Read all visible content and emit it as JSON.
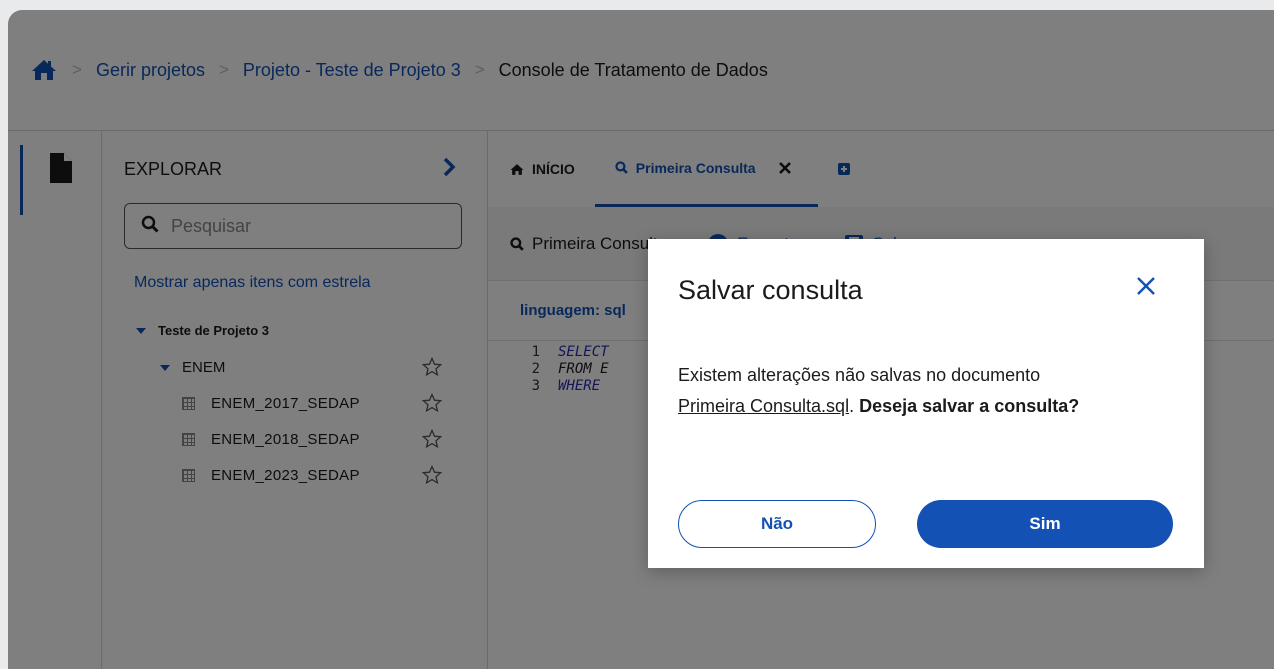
{
  "colors": {
    "accent": "#1351b4",
    "text": "#1b1b1b",
    "overlay": "rgba(0,0,0,0.5)"
  },
  "breadcrumb": {
    "home_icon": "home-icon",
    "items": [
      "Gerir projetos",
      "Projeto - Teste de Projeto 3"
    ],
    "current": "Console de Tratamento de Dados",
    "separator": ">"
  },
  "activity_bar": {
    "icon": "file-icon"
  },
  "explorer": {
    "title": "EXPLORAR",
    "search_placeholder": "Pesquisar",
    "starred_filter": "Mostrar apenas itens com estrela",
    "tree": {
      "project": "Teste de Projeto 3",
      "folder": "ENEM",
      "tables": [
        "ENEM_2017_SEDAP",
        "ENEM_2018_SEDAP",
        "ENEM_2023_SEDAP"
      ]
    }
  },
  "tabs": {
    "home_label": "INÍCIO",
    "query_label": "Primeira Consulta"
  },
  "toolbar": {
    "title": "Primeira Consulta",
    "run_label": "Executar",
    "save_label": "Salvar"
  },
  "editor": {
    "language_label": "linguagem: sql",
    "lines": [
      {
        "num": "1",
        "code": "SELECT"
      },
      {
        "num": "2",
        "code": "FROM E"
      },
      {
        "num": "3",
        "code": "WHERE"
      }
    ]
  },
  "modal": {
    "title": "Salvar consulta",
    "body_prefix": "Existem alterações não salvas no documento",
    "doc_name": "Primeira Consulta.sql",
    "body_mid": ".",
    "body_question": "Deseja salvar a consulta?",
    "no_label": "Não",
    "yes_label": "Sim"
  }
}
